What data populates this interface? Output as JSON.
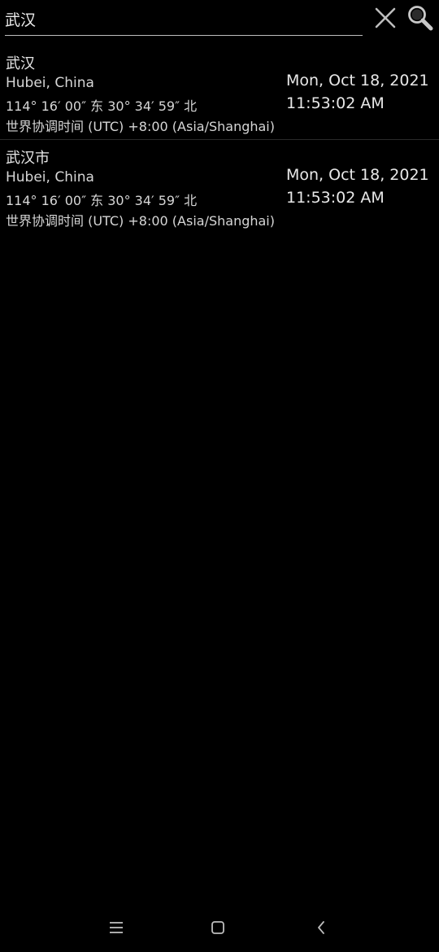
{
  "search": {
    "value": "武汉",
    "placeholder": ""
  },
  "icons": {
    "clear": "close-icon",
    "search": "search-icon"
  },
  "results": [
    {
      "name": "武汉",
      "region": "Hubei, China",
      "coords": "114° 16′ 00″ 东   30° 34′ 59″ 北",
      "timezone": "世界协调时间 (UTC) +8:00 (Asia/Shanghai)",
      "date": "Mon, Oct 18, 2021",
      "time": "11:53:02 AM"
    },
    {
      "name": "武汉市",
      "region": "Hubei, China",
      "coords": "114° 16′ 00″ 东   30° 34′ 59″ 北",
      "timezone": "世界协调时间 (UTC) +8:00 (Asia/Shanghai)",
      "date": "Mon, Oct 18, 2021",
      "time": "11:53:02 AM"
    }
  ],
  "nav": {
    "menu_icon": "menu-icon",
    "home_icon": "home-icon",
    "back_icon": "back-icon"
  },
  "colors": {
    "background": "#000000",
    "text": "#e6e6e6",
    "divider": "#2a2a2a"
  }
}
